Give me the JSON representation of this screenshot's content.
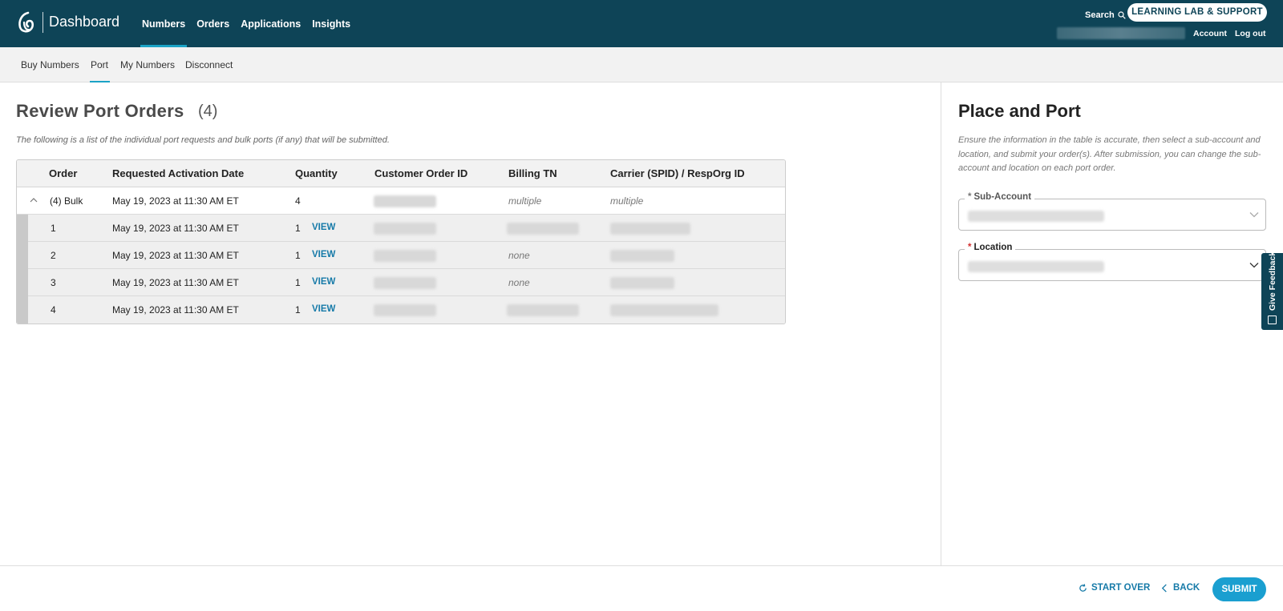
{
  "header": {
    "brand": "Dashboard",
    "nav": [
      {
        "label": "Numbers",
        "active": true
      },
      {
        "label": "Orders",
        "active": false
      },
      {
        "label": "Applications",
        "active": false
      },
      {
        "label": "Insights",
        "active": false
      }
    ],
    "search_label": "Search",
    "lab_button": "LEARNING LAB & SUPPORT",
    "account_link": "Account",
    "logout_link": "Log out"
  },
  "subnav": {
    "items": [
      {
        "label": "Buy Numbers",
        "active": false
      },
      {
        "label": "Port",
        "active": true
      },
      {
        "label": "My Numbers",
        "active": false
      },
      {
        "label": "Disconnect",
        "active": false
      }
    ]
  },
  "main": {
    "title": "Review Port Orders",
    "count": "(4)",
    "description": "The following is a list of the individual port requests and bulk ports (if any) that will be submitted.",
    "table": {
      "columns": [
        "Order",
        "Requested Activation Date",
        "Quantity",
        "Customer Order ID",
        "Billing TN",
        "Carrier (SPID) / RespOrg ID"
      ],
      "bulk_row": {
        "order": "(4) Bulk",
        "date": "May 19, 2023 at 11:30 AM ET",
        "quantity": "4",
        "billing": "multiple",
        "carrier": "multiple"
      },
      "rows": [
        {
          "order": "1",
          "date": "May 19, 2023 at 11:30 AM ET",
          "quantity": "1",
          "view": "VIEW",
          "billing": ""
        },
        {
          "order": "2",
          "date": "May 19, 2023 at 11:30 AM ET",
          "quantity": "1",
          "view": "VIEW",
          "billing": "none"
        },
        {
          "order": "3",
          "date": "May 19, 2023 at 11:30 AM ET",
          "quantity": "1",
          "view": "VIEW",
          "billing": "none"
        },
        {
          "order": "4",
          "date": "May 19, 2023 at 11:30 AM ET",
          "quantity": "1",
          "view": "VIEW",
          "billing": ""
        }
      ]
    }
  },
  "panel": {
    "title": "Place and Port",
    "description": "Ensure the information in the table is accurate, then select a sub-account and location, and submit your order(s). After submission, you can change the sub-account and location on each port order.",
    "sub_account_label": "Sub-Account",
    "location_label": "Location",
    "required_mark": "*"
  },
  "feedback_tab": "Give Feedback",
  "footer": {
    "start_over": "START OVER",
    "back": "BACK",
    "submit": "SUBMIT"
  },
  "colors": {
    "header_bg": "#0e4457",
    "accent": "#1ba3c6",
    "link": "#167aa8",
    "submit_bg": "#1a9fd0",
    "required": "#d32f2f"
  },
  "icons": [
    "logo-icon",
    "search-icon",
    "chevron-up-icon",
    "chevron-down-icon",
    "refresh-icon",
    "chevron-left-icon",
    "feedback-icon"
  ]
}
